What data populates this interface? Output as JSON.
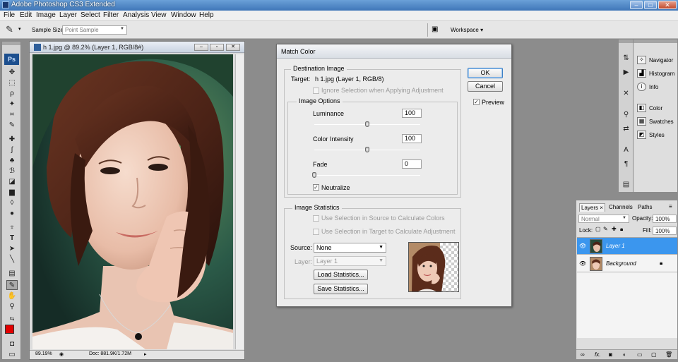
{
  "app": {
    "title": "Adobe Photoshop CS3 Extended",
    "window_buttons": [
      "–",
      "□",
      "✕"
    ]
  },
  "menu": [
    "File",
    "Edit",
    "Image",
    "Layer",
    "Select",
    "Filter",
    "Analysis",
    "View",
    "Window",
    "Help"
  ],
  "options_bar": {
    "sample_size_label": "Sample Size:",
    "sample_size_value": "Point Sample",
    "workspace_label": "Workspace ▾"
  },
  "toolbox": {
    "logo": "Ps",
    "tools": [
      "move-icon",
      "marquee-icon",
      "lasso-icon",
      "magic-wand-icon",
      "crop-icon",
      "eyedropper-icon",
      "healing-icon",
      "brush-icon",
      "clone-stamp-icon",
      "history-brush-icon",
      "eraser-icon",
      "gradient-icon",
      "blur-icon",
      "dodge-icon",
      "pen-icon",
      "type-icon",
      "path-select-icon",
      "shape-icon",
      "notes-icon",
      "eyedropper-active-icon",
      "hand-icon",
      "zoom-icon"
    ],
    "foreground_color": "#e20000"
  },
  "document": {
    "title": "h 1.jpg @ 89.2% (Layer 1, RGB/8#)",
    "zoom": "89.19%",
    "doc_size": "Doc: 881.9K/1.72M"
  },
  "dialog": {
    "title": "Match Color",
    "destination": {
      "group_title": "Destination Image",
      "target_label": "Target:",
      "target_value": "h 1.jpg (Layer 1, RGB/8)",
      "ignore_selection": "Ignore Selection when Applying Adjustment"
    },
    "image_options": {
      "group_title": "Image Options",
      "luminance_label": "Luminance",
      "luminance_value": "100",
      "luminance_level": 0.5,
      "intensity_label": "Color Intensity",
      "intensity_value": "100",
      "intensity_level": 0.5,
      "fade_label": "Fade",
      "fade_value": "0",
      "fade_level": 0.0,
      "neutralize_label": "Neutralize",
      "neutralize_checked": true
    },
    "statistics": {
      "group_title": "Image Statistics",
      "use_sel_source": "Use Selection in Source to Calculate Colors",
      "use_sel_target": "Use Selection in Target to Calculate Adjustment",
      "source_label": "Source:",
      "source_value": "None",
      "layer_label": "Layer:",
      "layer_value": "Layer 1",
      "load_button": "Load Statistics...",
      "save_button": "Save Statistics..."
    },
    "ok_button": "OK",
    "cancel_button": "Cancel",
    "preview_label": "Preview",
    "preview_checked": true
  },
  "dock": {
    "panels": [
      "Navigator",
      "Histogram",
      "Info",
      "Color",
      "Swatches",
      "Styles"
    ]
  },
  "layers_panel": {
    "tabs": [
      "Layers ×",
      "Channels",
      "Paths"
    ],
    "blend_mode": "Normal",
    "opacity_label": "Opacity:",
    "opacity_value": "100%",
    "lock_label": "Lock:",
    "fill_label": "Fill:",
    "fill_value": "100%",
    "layers": [
      {
        "name": "Layer 1",
        "selected": true
      },
      {
        "name": "Background",
        "selected": false
      }
    ],
    "footer_icons": [
      "link-icon",
      "fx-icon",
      "mask-icon",
      "adjustment-icon",
      "group-icon",
      "new-layer-icon",
      "trash-icon"
    ],
    "footer_fx": "fx."
  }
}
